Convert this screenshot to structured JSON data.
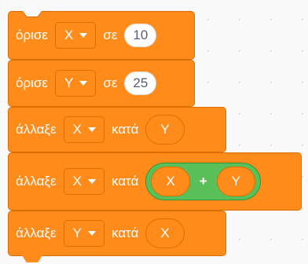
{
  "blocks": [
    {
      "verb": "όρισε",
      "variable": "X",
      "prep": "σε",
      "value": "10"
    },
    {
      "verb": "όρισε",
      "variable": "Y",
      "prep": "σε",
      "value": "25"
    },
    {
      "verb": "άλλαξε",
      "variable": "X",
      "prep": "κατά",
      "reporter": "Y"
    },
    {
      "verb": "άλλαξε",
      "variable": "X",
      "prep": "κατά",
      "left": "X",
      "operator": "+",
      "right": "Y"
    },
    {
      "verb": "άλλαξε",
      "variable": "Y",
      "prep": "κατά",
      "reporter": "X"
    }
  ],
  "colors": {
    "variables_block": "#ff8c1a",
    "variables_border": "#db6e00",
    "operator_block": "#59c059",
    "operator_border": "#389438",
    "canvas": "#f9f9f9"
  },
  "icons": {
    "dropdown": "caret-down-icon"
  }
}
